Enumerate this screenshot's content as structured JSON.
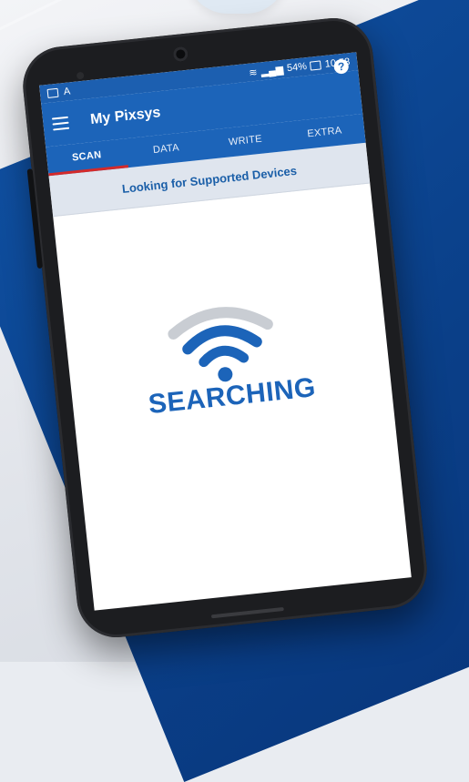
{
  "status_bar": {
    "left_icons": [
      "image-icon",
      "a-letter-icon"
    ],
    "battery": "54%",
    "time": "10:58",
    "icons": [
      "wifi-icon",
      "signal-icon",
      "battery-icon"
    ]
  },
  "app_bar": {
    "title": "My Pixsys",
    "menu_icon": "menu-icon",
    "help_icon": "help-icon",
    "help_symbol": "?"
  },
  "tabs": [
    {
      "label": "SCAN",
      "active": true
    },
    {
      "label": "DATA",
      "active": false
    },
    {
      "label": "WRITE",
      "active": false
    },
    {
      "label": "EXTRA",
      "active": false
    }
  ],
  "status_message": "Looking for Supported Devices",
  "main": {
    "searching_label": "SEARCHING",
    "wifi_icon": "wifi-searching-icon"
  },
  "colors": {
    "brand_blue": "#1c64b9",
    "tab_indicator": "#d42a2a",
    "strip_bg": "#dfe5ee"
  }
}
